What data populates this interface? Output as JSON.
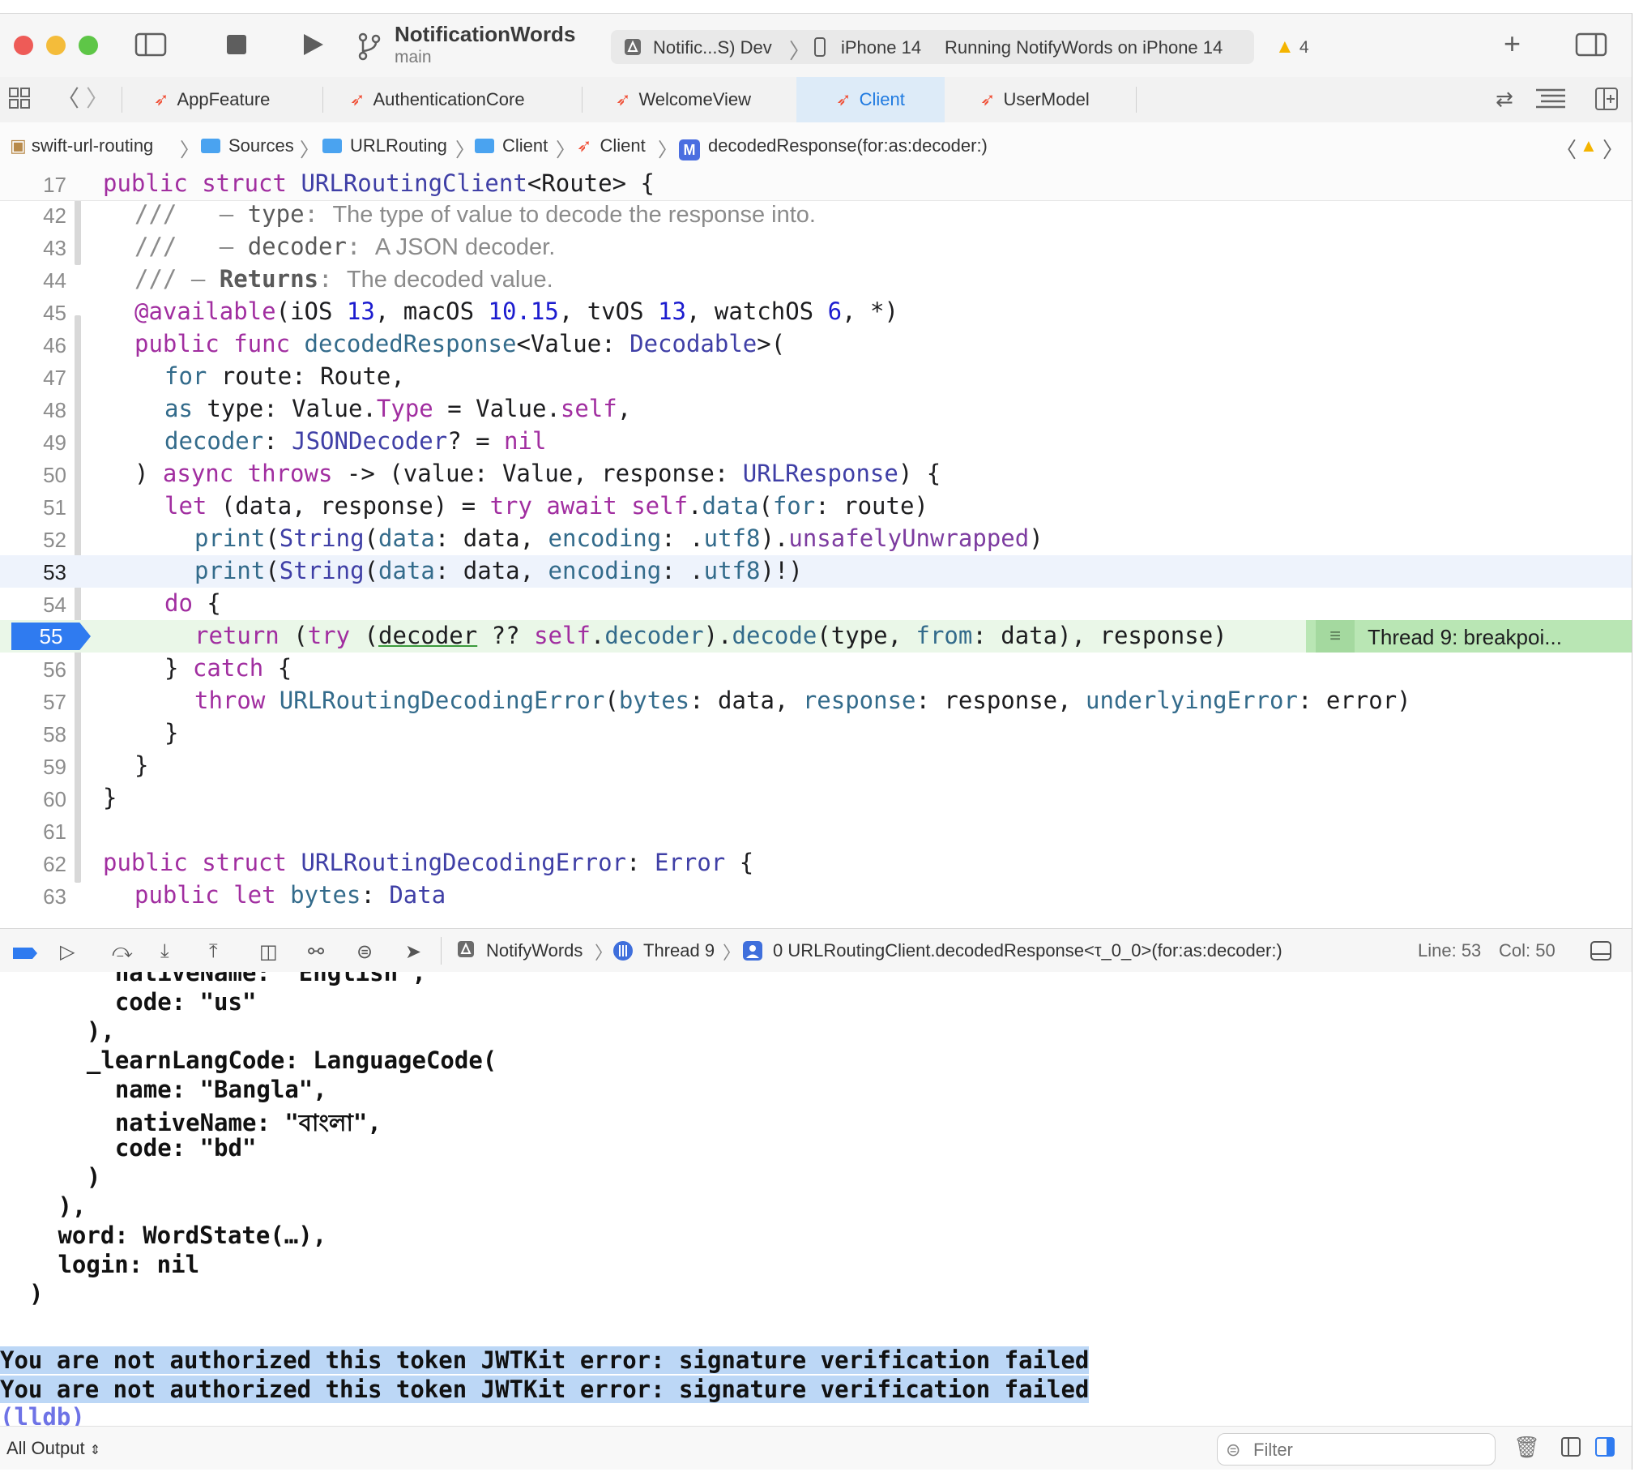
{
  "toolbar": {
    "project_name": "NotificationWords",
    "branch": "main",
    "scheme_target": "Notific...S) Dev",
    "device": "iPhone 14",
    "status": "Running NotifyWords on iPhone 14",
    "warning_count": "4"
  },
  "tabs": [
    {
      "label": "AppFeature"
    },
    {
      "label": "AuthenticationCore"
    },
    {
      "label": "WelcomeView"
    },
    {
      "label": "Client"
    },
    {
      "label": "UserModel"
    }
  ],
  "breadcrumb": {
    "project": "swift-url-routing",
    "sources": "Sources",
    "module": "URLRouting",
    "folder": "Client",
    "file": "Client",
    "symbol": "decodedResponse(for:as:decoder:)"
  },
  "editor": {
    "sticky_line_number": "17",
    "sticky_line": "public struct URLRoutingClient<Route> {",
    "thread_annotation": "Thread 9: breakpoi...",
    "lines": [
      {
        "n": "42",
        "text": "///   – type: The type of value to decode the response into."
      },
      {
        "n": "43",
        "text": "///   – decoder: A JSON decoder."
      },
      {
        "n": "44",
        "text": "/// – Returns: The decoded value."
      },
      {
        "n": "45",
        "text": "@available(iOS 13, macOS 10.15, tvOS 13, watchOS 6, *)"
      },
      {
        "n": "46",
        "text": "public func decodedResponse<Value: Decodable>("
      },
      {
        "n": "47",
        "text": "for route: Route,"
      },
      {
        "n": "48",
        "text": "as type: Value.Type = Value.self,"
      },
      {
        "n": "49",
        "text": "decoder: JSONDecoder? = nil"
      },
      {
        "n": "50",
        "text": ") async throws -> (value: Value, response: URLResponse) {"
      },
      {
        "n": "51",
        "text": "let (data, response) = try await self.data(for: route)"
      },
      {
        "n": "52",
        "text": "print(String(data: data, encoding: .utf8).unsafelyUnwrapped)"
      },
      {
        "n": "53",
        "text": "print(String(data: data, encoding: .utf8)!)"
      },
      {
        "n": "54",
        "text": "do {"
      },
      {
        "n": "55",
        "text": "return (try (decoder ?? self.decoder).decode(type, from: data), response)"
      },
      {
        "n": "56",
        "text": "} catch {"
      },
      {
        "n": "57",
        "text": "throw URLRoutingDecodingError(bytes: data, response: response, underlyingError: error)"
      },
      {
        "n": "58",
        "text": "}"
      },
      {
        "n": "59",
        "text": "}"
      },
      {
        "n": "60",
        "text": "}"
      },
      {
        "n": "61",
        "text": ""
      },
      {
        "n": "62",
        "text": "public struct URLRoutingDecodingError: Error {"
      },
      {
        "n": "63",
        "text": "public let bytes: Data"
      }
    ]
  },
  "debugbar": {
    "app": "NotifyWords",
    "thread": "Thread 9",
    "frame": "0 URLRoutingClient.decodedResponse<τ_0_0>(for:as:decoder:)",
    "line": "Line: 53",
    "col": "Col: 50"
  },
  "console": {
    "lines": [
      "    nativeName: \"English\",",
      "    code: \"us\"",
      "  ),",
      "  _learnLangCode: LanguageCode(",
      "    name: \"Bangla\",",
      "    nativeName: \"বাংলা\",",
      "    code: \"bd\"",
      "  )",
      " ),",
      " word: WordState(…),",
      " login: nil",
      ")"
    ],
    "errors": [
      "You are not authorized this token JWTKit error: signature verification failed",
      "You are not authorized this token JWTKit error: signature verification failed"
    ],
    "prompt": "(lldb)"
  },
  "bottombar": {
    "output_selector": "All Output",
    "filter_placeholder": "Filter"
  }
}
